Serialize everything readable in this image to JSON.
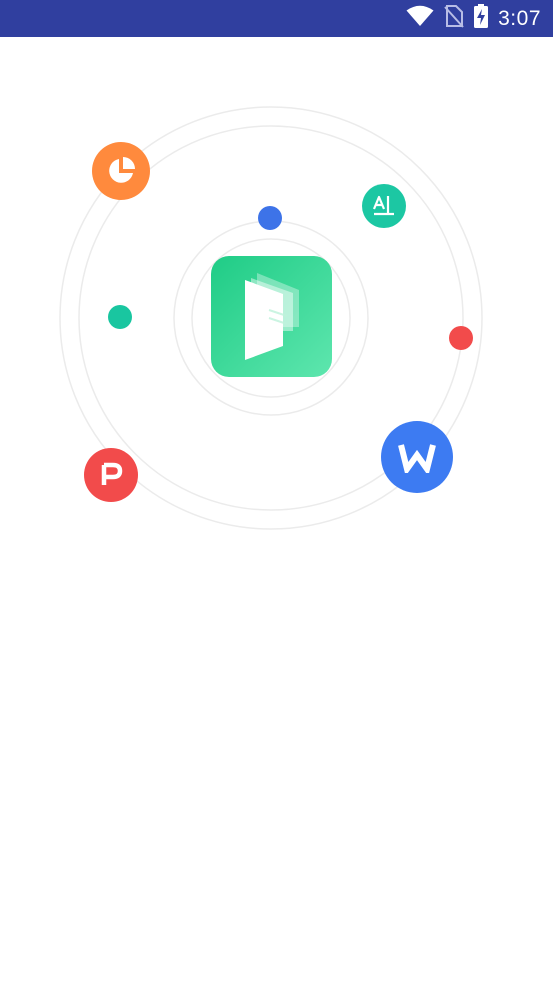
{
  "status_bar": {
    "time": "3:07",
    "background": "#303F9F",
    "icons": [
      "wifi-icon",
      "no-sim-icon",
      "battery-charging-icon"
    ]
  },
  "splash": {
    "logo": {
      "icon": "document-book-icon",
      "gradient": [
        "#1fcc86",
        "#5ee6ae"
      ]
    },
    "bubbles": [
      {
        "name": "chart-file-bubble",
        "icon": "pie-chart-icon",
        "color": "#FF8A3D"
      },
      {
        "name": "translate-file-bubble",
        "icon": "text-translate-icon",
        "color": "#1CC7A3"
      },
      {
        "name": "word-file-bubble",
        "icon": "word-icon",
        "label": "W",
        "color": "#3D7BF2"
      },
      {
        "name": "ppt-file-bubble",
        "icon": "ppt-icon",
        "label": "P",
        "color": "#F24B4B"
      }
    ],
    "dots": [
      {
        "name": "blue-dot",
        "color": "#3D73E8"
      },
      {
        "name": "green-dot",
        "color": "#19C6A0"
      },
      {
        "name": "red-dot",
        "color": "#F24B4B"
      }
    ]
  }
}
